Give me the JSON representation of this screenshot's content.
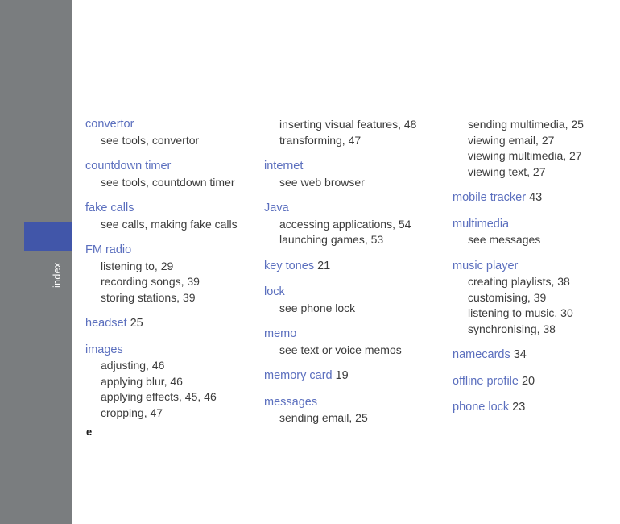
{
  "sidebar": {
    "label": "index",
    "bg_color": "#7a7d7f",
    "tab_color": "#4156a9",
    "label_color": "#ffffff"
  },
  "page": {
    "number": "e",
    "heading_color": "#5b6fbe",
    "body_color": "#3c3c3c",
    "background": "#ffffff"
  },
  "columns": [
    {
      "name": "column-1",
      "entries": [
        {
          "heading": "convertor",
          "page": "",
          "subentries": [
            {
              "text": "see tools, convertor"
            }
          ]
        },
        {
          "heading": "countdown timer",
          "page": "",
          "subentries": [
            {
              "text": "see tools, countdown timer"
            }
          ]
        },
        {
          "heading": "fake calls",
          "page": "",
          "subentries": [
            {
              "text": "see calls, making fake calls"
            }
          ]
        },
        {
          "heading": "FM radio",
          "page": "",
          "subentries": [
            {
              "text": "listening to,  29"
            },
            {
              "text": "recording songs,  39"
            },
            {
              "text": "storing stations,  39"
            }
          ]
        },
        {
          "heading": "headset",
          "page": "25",
          "subentries": []
        },
        {
          "heading": "images",
          "page": "",
          "subentries": [
            {
              "text": "adjusting,  46"
            },
            {
              "text": "applying blur,  46"
            },
            {
              "text": "applying effects,  45,  46"
            },
            {
              "text": "cropping,  47"
            }
          ]
        }
      ]
    },
    {
      "name": "column-2",
      "continuation": [
        {
          "text": "inserting visual features,  48"
        },
        {
          "text": "transforming,  47"
        }
      ],
      "entries": [
        {
          "heading": "internet",
          "page": "",
          "subentries": [
            {
              "text": "see web browser"
            }
          ]
        },
        {
          "heading": "Java",
          "page": "",
          "subentries": [
            {
              "text": "accessing applications,  54"
            },
            {
              "text": "launching games,  53"
            }
          ]
        },
        {
          "heading": "key tones",
          "page": "21",
          "subentries": []
        },
        {
          "heading": "lock",
          "page": "",
          "subentries": [
            {
              "text": "see phone lock"
            }
          ]
        },
        {
          "heading": "memo",
          "page": "",
          "subentries": [
            {
              "text": "see text or voice memos"
            }
          ]
        },
        {
          "heading": "memory card",
          "page": "19",
          "subentries": []
        },
        {
          "heading": "messages",
          "page": "",
          "subentries": [
            {
              "text": "sending email,  25"
            }
          ]
        }
      ]
    },
    {
      "name": "column-3",
      "continuation": [
        {
          "text": "sending multimedia,  25"
        },
        {
          "text": "viewing email,  27"
        },
        {
          "text": "viewing multimedia,  27"
        },
        {
          "text": "viewing text,  27"
        }
      ],
      "entries": [
        {
          "heading": "mobile tracker",
          "page": "43",
          "subentries": []
        },
        {
          "heading": "multimedia",
          "page": "",
          "subentries": [
            {
              "text": "see messages"
            }
          ]
        },
        {
          "heading": "music player",
          "page": "",
          "subentries": [
            {
              "text": "creating playlists,  38"
            },
            {
              "text": "customising,  39"
            },
            {
              "text": "listening to music,  30"
            },
            {
              "text": "synchronising,  38"
            }
          ]
        },
        {
          "heading": "namecards",
          "page": "34",
          "subentries": []
        },
        {
          "heading": "offline profile",
          "page": "20",
          "subentries": []
        },
        {
          "heading": "phone lock",
          "page": "23",
          "subentries": []
        }
      ]
    }
  ]
}
